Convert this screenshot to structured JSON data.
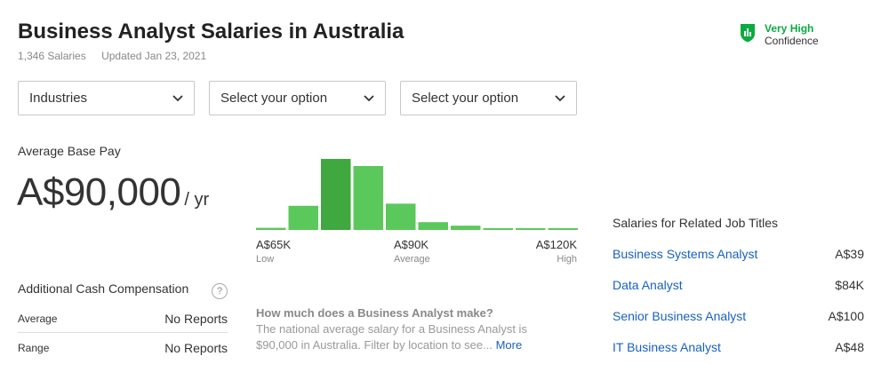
{
  "header": {
    "title": "Business Analyst Salaries in Australia",
    "salary_count": "1,346 Salaries",
    "updated": "Updated Jan 23, 2021"
  },
  "confidence": {
    "level": "Very High",
    "label": "Confidence",
    "icon": "shield-bar-chart-icon",
    "color": "#0caa41"
  },
  "filters": [
    {
      "label": "Industries"
    },
    {
      "label": "Select your option"
    },
    {
      "label": "Select your option"
    }
  ],
  "pay": {
    "label": "Average Base Pay",
    "value": "A$90,000",
    "unit": "/ yr"
  },
  "histogram": {
    "bar_color": "#5bc85b",
    "highlight_color": "#3fa83f",
    "relative_heights": [
      0.03,
      0.34,
      1.0,
      0.9,
      0.37,
      0.11,
      0.06,
      0.02,
      0.02,
      0.02
    ],
    "highlight_index": 2,
    "axis": [
      {
        "value": "A$65K",
        "label": "Low"
      },
      {
        "value": "A$90K",
        "label": "Average"
      },
      {
        "value": "A$120K",
        "label": "High"
      }
    ]
  },
  "additional_comp": {
    "title": "Additional Cash Compensation",
    "help_icon": "question-mark-icon",
    "rows": [
      {
        "key": "Average",
        "value": "No Reports"
      },
      {
        "key": "Range",
        "value": "No Reports"
      }
    ]
  },
  "faq": {
    "question": "How much does a Business Analyst make?",
    "answer": "The national average salary for a Business Analyst is $90,000 in Australia. Filter by location to see...",
    "more": "More"
  },
  "related": {
    "title": "Salaries for Related Job Titles",
    "items": [
      {
        "title": "Business Systems Analyst",
        "amount": "A$39"
      },
      {
        "title": "Data Analyst",
        "amount": "$84K"
      },
      {
        "title": "Senior Business Analyst",
        "amount": "A$100"
      },
      {
        "title": "IT Business Analyst",
        "amount": "A$48"
      }
    ]
  }
}
